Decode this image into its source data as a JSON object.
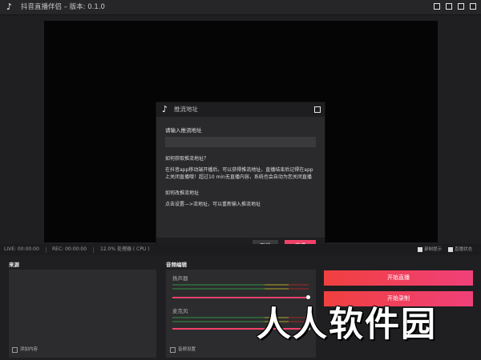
{
  "app": {
    "logo_icon": "douyin-note-icon",
    "logo_glyph": "♪",
    "title": "抖音直播伴侣 – 版本: 0.1.0"
  },
  "dialog": {
    "logo_glyph": "♪",
    "title": "推流地址",
    "input_label": "请输入推流地址",
    "input_value": "",
    "help_heading": "如何获取推流地址？",
    "help_body": "在抖音app移动端开播后，可以获得推流地址，直播结束后记得在app上关闭直播哦！超过10 min无直播内容，系统也会自动为您关闭直播",
    "change_heading": "如何改推流地址",
    "change_body": "点击设置—>流地址，可以重新输入推流地址",
    "cancel_label": "取消",
    "done_label": "完成"
  },
  "status": {
    "live": "LIVE: 00:00:00",
    "rec": "REC: 00:00:00",
    "cpu": "12.0% 处理器 ( CPU )",
    "record_hint": "录制提示",
    "live_state": "直播状态"
  },
  "source": {
    "title": "来源",
    "add_label": "添加内容"
  },
  "audio": {
    "title": "音频编辑",
    "speaker_label": "扬声器",
    "speaker_volume": 1.0,
    "mic_label": "麦克风",
    "mic_volume": 1.0,
    "settings_label": "音频设置"
  },
  "actions": {
    "start_live": "开始直播",
    "start_record": "开始录制"
  },
  "watermark": "人人软件园",
  "colors": {
    "accent": "#f0426a",
    "background": "#1f1f21"
  }
}
